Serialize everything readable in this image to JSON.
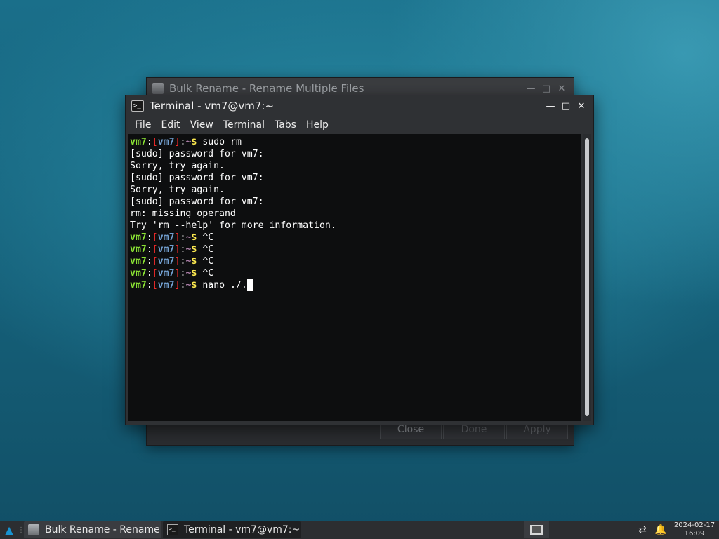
{
  "bulk_rename_window": {
    "title": "Bulk Rename - Rename Multiple Files",
    "buttons": {
      "close": "Close",
      "done": "Done",
      "apply": "Apply"
    }
  },
  "terminal_window": {
    "title": "Terminal - vm7@vm7:~",
    "menu": [
      "File",
      "Edit",
      "View",
      "Terminal",
      "Tabs",
      "Help"
    ],
    "prompt": {
      "user": "vm7",
      "host": "vm7",
      "path": "~"
    },
    "lines": [
      {
        "type": "prompt",
        "command": "sudo rm"
      },
      {
        "type": "output",
        "text": "[sudo] password for vm7:"
      },
      {
        "type": "output",
        "text": "Sorry, try again."
      },
      {
        "type": "output",
        "text": "[sudo] password for vm7:"
      },
      {
        "type": "output",
        "text": "Sorry, try again."
      },
      {
        "type": "output",
        "text": "[sudo] password for vm7:"
      },
      {
        "type": "output",
        "text": "rm: missing operand"
      },
      {
        "type": "output",
        "text": "Try 'rm --help' for more information."
      },
      {
        "type": "prompt",
        "command": "^C"
      },
      {
        "type": "prompt",
        "command": "^C"
      },
      {
        "type": "prompt",
        "command": "^C"
      },
      {
        "type": "prompt",
        "command": "^C"
      },
      {
        "type": "prompt",
        "command": "nano ./.",
        "cursor": true
      }
    ]
  },
  "taskbar": {
    "tasks": [
      {
        "label": "Bulk Rename - Rename ...",
        "icon": "bulk-rename-icon"
      },
      {
        "label": "Terminal - vm7@vm7:~",
        "icon": "terminal-icon"
      }
    ],
    "clock": {
      "date": "2024-02-17",
      "time": "16:09"
    }
  },
  "colors": {
    "prompt_user": "#8ae234",
    "prompt_bracket": "#ef2929",
    "prompt_host": "#729fcf",
    "prompt_path": "#ad7fa8",
    "prompt_dollar": "#fce94f",
    "terminal_bg": "#0d0e0f"
  }
}
